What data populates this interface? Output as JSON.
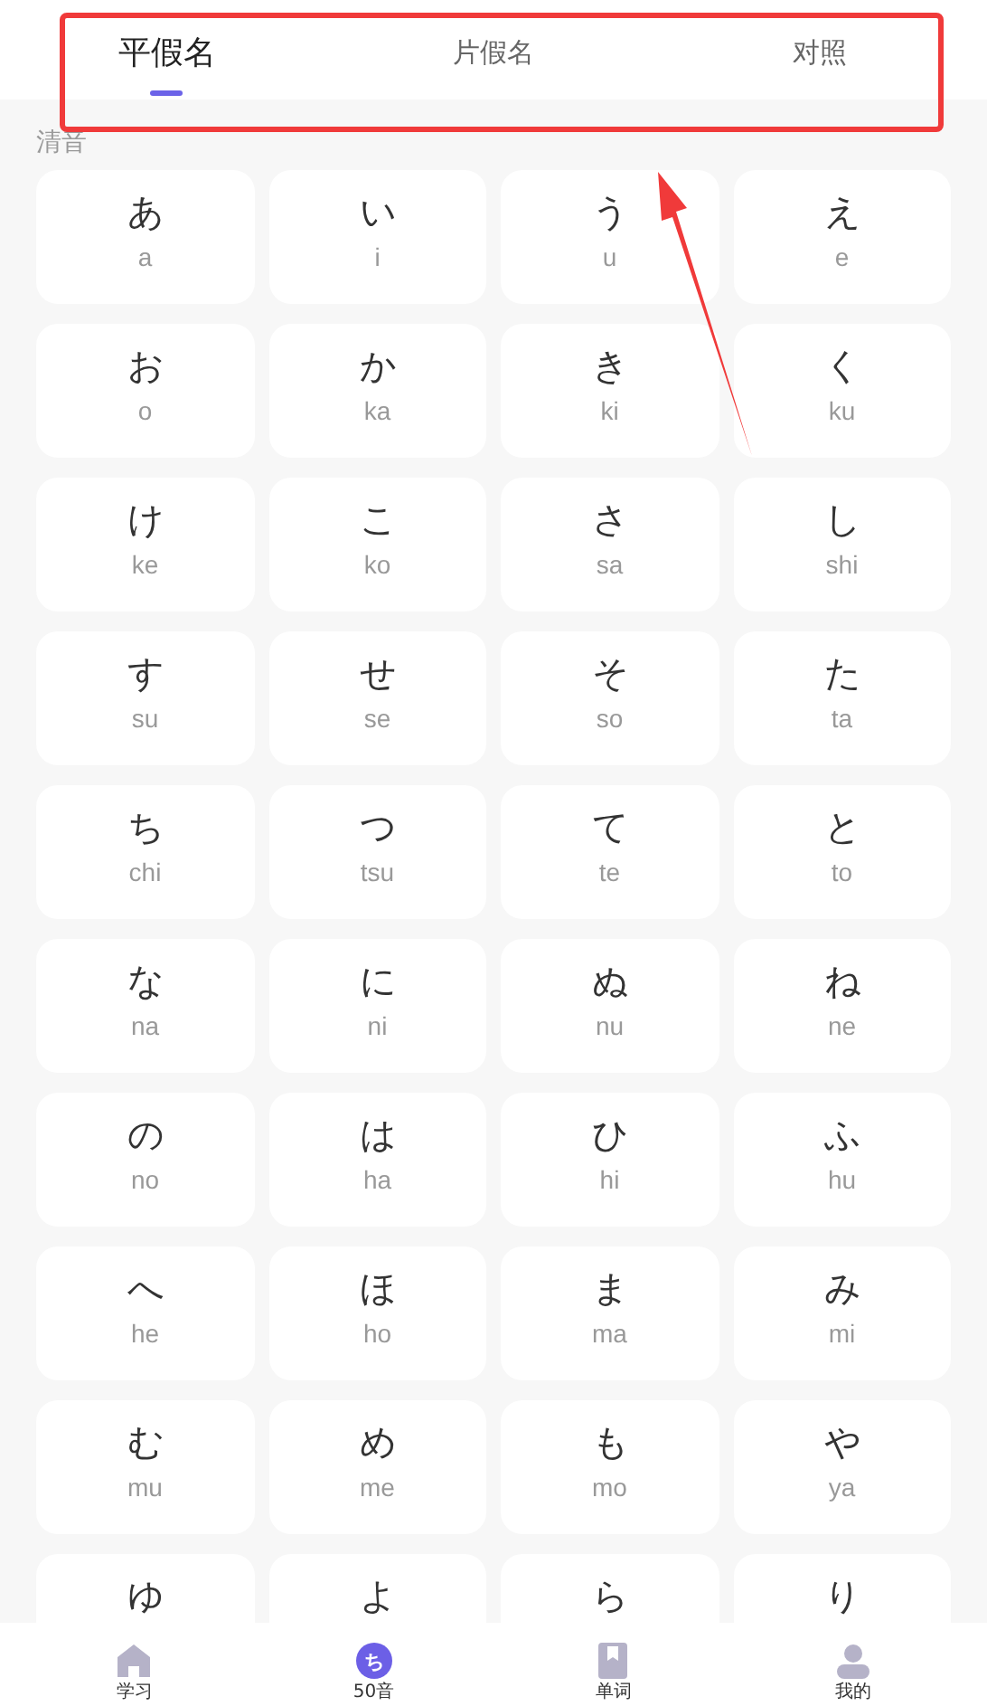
{
  "tabs": [
    {
      "label": "平假名",
      "selected": true
    },
    {
      "label": "片假名",
      "selected": false
    },
    {
      "label": "对照",
      "selected": false
    }
  ],
  "section_title": "清音",
  "kana": [
    {
      "kana": "あ",
      "romaji": "a"
    },
    {
      "kana": "い",
      "romaji": "i"
    },
    {
      "kana": "う",
      "romaji": "u"
    },
    {
      "kana": "え",
      "romaji": "e"
    },
    {
      "kana": "お",
      "romaji": "o"
    },
    {
      "kana": "か",
      "romaji": "ka"
    },
    {
      "kana": "き",
      "romaji": "ki"
    },
    {
      "kana": "く",
      "romaji": "ku"
    },
    {
      "kana": "け",
      "romaji": "ke"
    },
    {
      "kana": "こ",
      "romaji": "ko"
    },
    {
      "kana": "さ",
      "romaji": "sa"
    },
    {
      "kana": "し",
      "romaji": "shi"
    },
    {
      "kana": "す",
      "romaji": "su"
    },
    {
      "kana": "せ",
      "romaji": "se"
    },
    {
      "kana": "そ",
      "romaji": "so"
    },
    {
      "kana": "た",
      "romaji": "ta"
    },
    {
      "kana": "ち",
      "romaji": "chi"
    },
    {
      "kana": "つ",
      "romaji": "tsu"
    },
    {
      "kana": "て",
      "romaji": "te"
    },
    {
      "kana": "と",
      "romaji": "to"
    },
    {
      "kana": "な",
      "romaji": "na"
    },
    {
      "kana": "に",
      "romaji": "ni"
    },
    {
      "kana": "ぬ",
      "romaji": "nu"
    },
    {
      "kana": "ね",
      "romaji": "ne"
    },
    {
      "kana": "の",
      "romaji": "no"
    },
    {
      "kana": "は",
      "romaji": "ha"
    },
    {
      "kana": "ひ",
      "romaji": "hi"
    },
    {
      "kana": "ふ",
      "romaji": "hu"
    },
    {
      "kana": "へ",
      "romaji": "he"
    },
    {
      "kana": "ほ",
      "romaji": "ho"
    },
    {
      "kana": "ま",
      "romaji": "ma"
    },
    {
      "kana": "み",
      "romaji": "mi"
    },
    {
      "kana": "む",
      "romaji": "mu"
    },
    {
      "kana": "め",
      "romaji": "me"
    },
    {
      "kana": "も",
      "romaji": "mo"
    },
    {
      "kana": "や",
      "romaji": "ya"
    },
    {
      "kana": "ゆ"
    },
    {
      "kana": "よ"
    },
    {
      "kana": "ら"
    },
    {
      "kana": "り"
    }
  ],
  "bottom_nav": [
    {
      "kind": "home",
      "label": "学习",
      "selected": false
    },
    {
      "kind": "badge",
      "icon_text": "ち",
      "label": "50音",
      "selected": true
    },
    {
      "kind": "book",
      "label": "单词",
      "selected": false
    },
    {
      "kind": "person",
      "label": "我的",
      "selected": false
    }
  ]
}
